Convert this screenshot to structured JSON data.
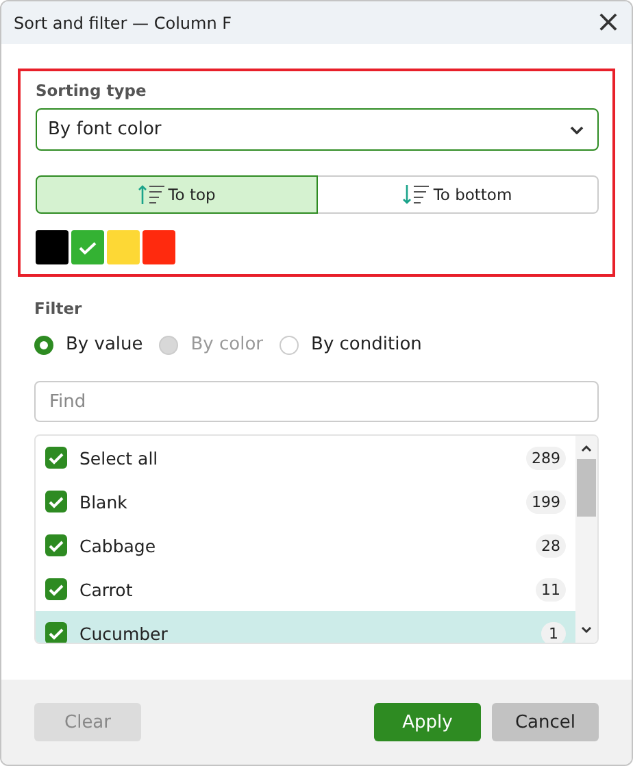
{
  "window": {
    "title": "Sort and filter — Column F",
    "close": "×"
  },
  "sorting": {
    "label": "Sorting type",
    "dropdown": {
      "value": "By font color"
    },
    "directions": [
      {
        "label": "To top",
        "kind": "up",
        "selected": true
      },
      {
        "label": "To bottom",
        "kind": "down",
        "selected": false
      }
    ],
    "swatches": [
      {
        "color": "#000000",
        "selected": false
      },
      {
        "color": "#34b233",
        "selected": true
      },
      {
        "color": "#fdd835",
        "selected": false
      },
      {
        "color": "#ff2a0e",
        "selected": false
      }
    ]
  },
  "filter": {
    "label": "Filter",
    "modes": [
      {
        "label": "By value",
        "selected": true,
        "disabled": false
      },
      {
        "label": "By color",
        "selected": false,
        "disabled": true
      },
      {
        "label": "By condition",
        "selected": false,
        "disabled": false
      }
    ],
    "search": {
      "placeholder": "Find"
    },
    "items": [
      {
        "label": "Select all",
        "count": "289",
        "checked": true,
        "selected": false
      },
      {
        "label": "Blank",
        "count": "199",
        "checked": true,
        "selected": false
      },
      {
        "label": "Cabbage",
        "count": "28",
        "checked": true,
        "selected": false
      },
      {
        "label": "Carrot",
        "count": "11",
        "checked": true,
        "selected": false
      },
      {
        "label": "Cucumber",
        "count": "1",
        "checked": true,
        "selected": true
      }
    ]
  },
  "buttons": [
    {
      "label": "Clear",
      "kind": "secondary",
      "disabled": true
    },
    {
      "label": "Apply",
      "kind": "primary",
      "disabled": false
    },
    {
      "label": "Cancel",
      "kind": "secondary",
      "disabled": false
    }
  ]
}
